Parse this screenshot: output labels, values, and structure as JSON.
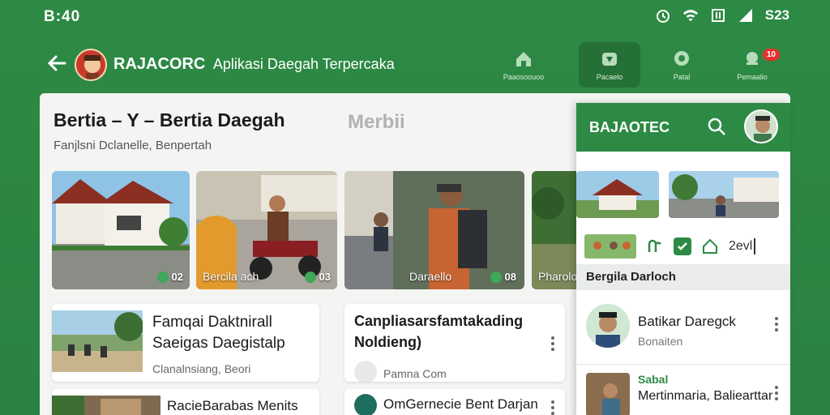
{
  "status": {
    "time": "B:40",
    "battery": "S23"
  },
  "appbar": {
    "title": "RAJACORC",
    "tagline": "Aplikasi Daegah Terpercaka",
    "nav": [
      {
        "label": "Paaosoouoo",
        "icon": "home-icon"
      },
      {
        "label": "Pacaelo",
        "icon": "news-icon"
      },
      {
        "label": "Patal",
        "icon": "location-icon"
      },
      {
        "label": "Pemaalio",
        "icon": "bell-icon",
        "badge": "10"
      }
    ]
  },
  "main": {
    "title": "Bertia – Y – Bertia Daegah",
    "subtitle": "Fanjlsni Dclanelle, Benpertah",
    "ghost_title": "Merbii",
    "tiles": [
      {
        "caption": "",
        "count": "02"
      },
      {
        "caption": "Bercila ach",
        "count": "03"
      },
      {
        "caption": "",
        "count": ""
      },
      {
        "caption": "Daraello",
        "count": "08"
      },
      {
        "caption": "Pharolo",
        "count": ""
      }
    ],
    "cards": [
      {
        "title_line1": "Famqai Daktnirall",
        "title_line2": "Saeigas Daegistalp",
        "meta": "Clanalnsiang, Beori"
      },
      {
        "title_line1": "Canpliasarsfamtakading",
        "title_line2": "Noldieng)",
        "meta": "Pamna Com"
      },
      {
        "title_line1": "RacieBarabas Menits",
        "meta": ""
      },
      {
        "title_line1": "OmGernecie Bent Darjan",
        "meta": ""
      }
    ]
  },
  "drawer": {
    "title": "BAJAOTEC",
    "input_value": "2evl",
    "section": "Bergila Darloch",
    "items": [
      {
        "title": "Batikar Daregck",
        "sub": "Bonaiten"
      },
      {
        "title": "Sabal",
        "sub": "Mertinmaria, Baliearttar"
      }
    ]
  },
  "colors": {
    "primary": "#2d8a44",
    "badge": "#e5322d",
    "panel": "#f4f5f3"
  }
}
